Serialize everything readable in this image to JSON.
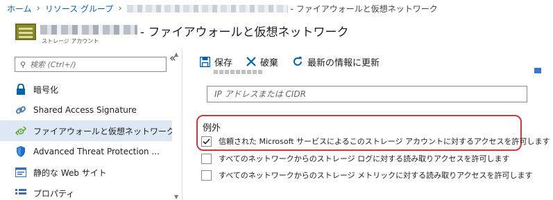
{
  "breadcrumb": {
    "home": "ホーム",
    "resource_groups": "リソース グループ",
    "current": "- ファイアウォールと仮想ネットワーク"
  },
  "resource": {
    "title": "- ファイアウォールと仮想ネットワーク",
    "subtitle": "ストレージ アカウント"
  },
  "sidebar": {
    "collapse_glyph": "«",
    "search_placeholder": "検索 (Ctrl+/)",
    "items": [
      {
        "label": "暗号化",
        "icon": "lock-icon"
      },
      {
        "label": "Shared Access Signature",
        "icon": "link-icon"
      },
      {
        "label": "ファイアウォールと仮想ネットワーク",
        "icon": "firewall-icon",
        "active": true
      },
      {
        "label": "Advanced Threat Protection ...",
        "icon": "shield-icon"
      },
      {
        "label": "静的な Web サイト",
        "icon": "website-icon"
      },
      {
        "label": "プロパティ",
        "icon": "properties-icon"
      }
    ]
  },
  "toolbar": {
    "save": "保存",
    "discard": "破棄",
    "refresh": "最新の情報に更新"
  },
  "main": {
    "ip_placeholder": "IP アドレスまたは CIDR",
    "exceptions_title": "例外",
    "exceptions": [
      {
        "label": "信頼された Microsoft サービスによるこのストレージ アカウントに対するアクセスを許可します",
        "checked": true,
        "info": true
      },
      {
        "label": "すべてのネットワークからのストレージ ログに対する読み取りアクセスを許可します",
        "checked": false
      },
      {
        "label": "すべてのネットワークからのストレージ メトリックに対する読み取りアクセスを許可します",
        "checked": false
      }
    ]
  },
  "colors": {
    "link": "#0062ad",
    "active_item": "#dde8f4",
    "highlight_border": "#d5343a",
    "toolbar_icon": "#0062ad"
  }
}
